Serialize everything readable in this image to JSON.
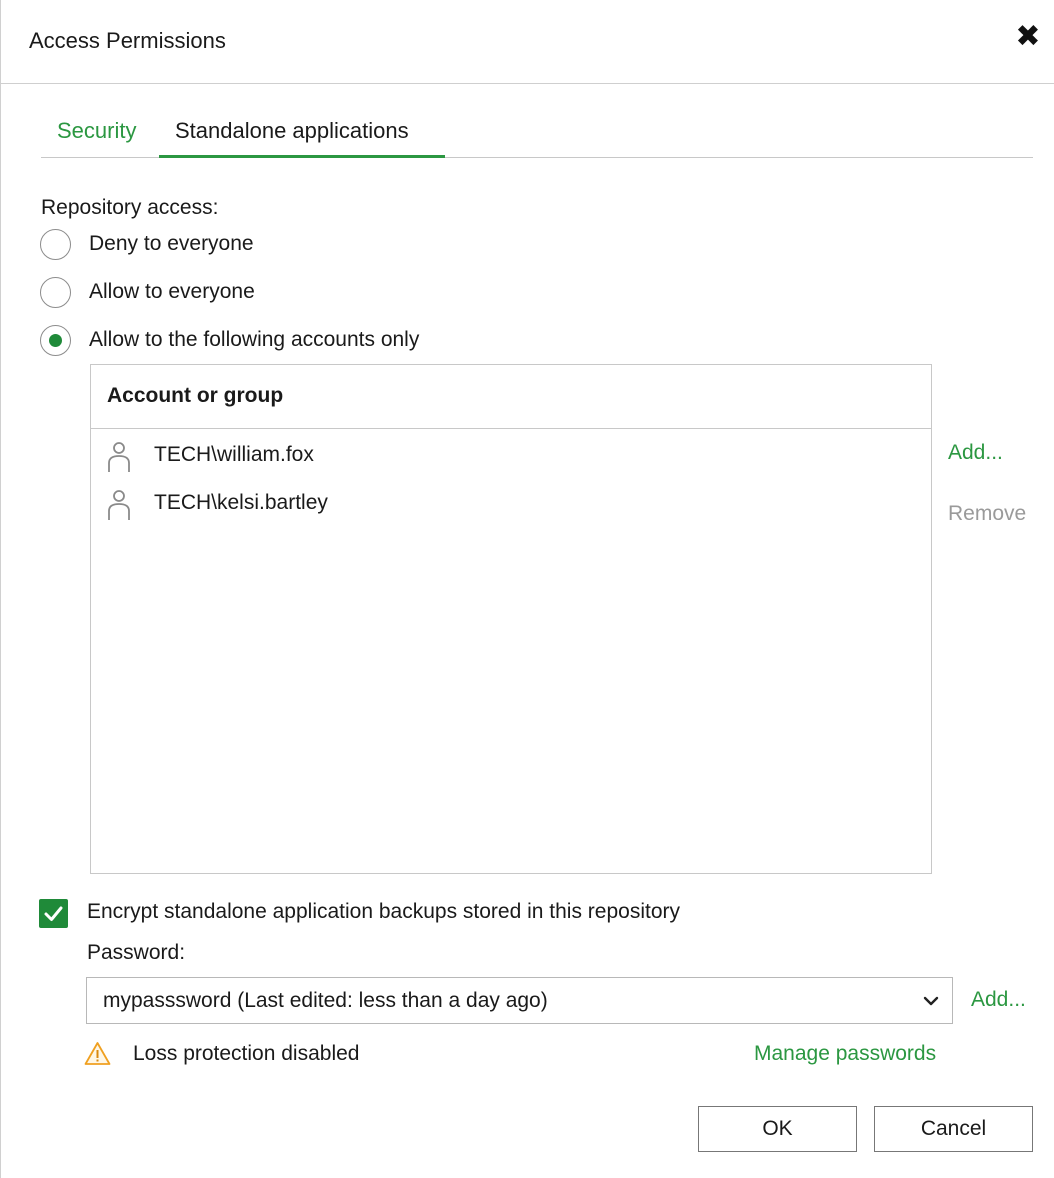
{
  "window": {
    "title": "Access Permissions",
    "close_glyph": "✖"
  },
  "tabs": [
    {
      "label": "Security",
      "active": false
    },
    {
      "label": "Standalone applications",
      "active": true
    }
  ],
  "repository_access": {
    "label": "Repository access:",
    "options": [
      {
        "label": "Deny to everyone",
        "selected": false
      },
      {
        "label": "Allow to everyone",
        "selected": false
      },
      {
        "label": "Allow to the following accounts only",
        "selected": true
      }
    ]
  },
  "accounts_table": {
    "column_header": "Account or group",
    "rows": [
      {
        "name": "TECH\\william.fox",
        "icon": "user-icon"
      },
      {
        "name": "TECH\\kelsi.bartley",
        "icon": "user-icon"
      }
    ],
    "add_label": "Add...",
    "remove_label": "Remove"
  },
  "encryption": {
    "checkbox_label": "Encrypt standalone application backups stored in this repository",
    "checked": true,
    "password_label": "Password:",
    "password_value": "mypasssword (Last edited: less than a day ago)",
    "add_label": "Add...",
    "warning_text": "Loss protection disabled",
    "manage_label": "Manage passwords"
  },
  "footer": {
    "ok_label": "OK",
    "cancel_label": "Cancel"
  },
  "colors": {
    "accent": "#2b9741",
    "radio_dot": "#1f8a39",
    "disabled_text": "#9a9a9a",
    "warning": "#f0a020"
  }
}
